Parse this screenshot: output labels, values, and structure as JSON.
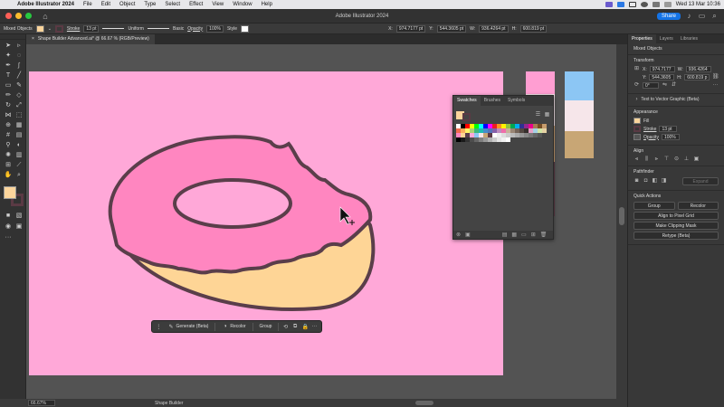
{
  "menubar": {
    "app": "Adobe Illustrator 2024",
    "items": [
      "File",
      "Edit",
      "Object",
      "Type",
      "Select",
      "Effect",
      "View",
      "Window",
      "Help"
    ],
    "datetime": "Wed 13 Mar  10:36"
  },
  "titlebar": {
    "title": "Adobe Illustrator 2024",
    "share": "Share"
  },
  "control": {
    "selection": "Mixed Objects",
    "stroke_label": "Stroke",
    "stroke_weight": "13 pt",
    "profile": "Uniform",
    "brush": "Basic",
    "opacity_label": "Opacity",
    "opacity": "100%",
    "style_label": "Style",
    "x": "974.7177 pt",
    "y": "544.3605 pt",
    "w": "936.4264 pt",
    "h": "600.819 pt",
    "fill_color": "#fcd59c",
    "stroke_color": "#5a3a44"
  },
  "doc": {
    "tab": "Shape Builder Advanced.ai* @ 66.67 % (RGB/Preview)",
    "close": "×"
  },
  "colors": {
    "artboard": "#ffa8d8",
    "frosting": "#ff86c0",
    "dough": "#fed596",
    "outline": "#5a3e4a"
  },
  "strips": [
    [
      "#ff9ed2",
      "#f6e6ea",
      "#c89d70",
      "#5c3a46"
    ],
    [
      "#8cc6f4",
      "#f6e6ea",
      "#c8a675"
    ]
  ],
  "swatches_panel": {
    "tabs": [
      "Swatches",
      "Brushes",
      "Symbols"
    ]
  },
  "taskbar": {
    "generate": "Generate (Beta)",
    "recolor": "Recolor",
    "group": "Group",
    "more": "···"
  },
  "status": {
    "zoom": "66.67%",
    "tool": "Shape Builder"
  },
  "properties": {
    "tabs": [
      "Properties",
      "Layers",
      "Libraries"
    ],
    "selection": "Mixed Objects",
    "transform_title": "Transform",
    "x": "974.7177",
    "y": "544.3605",
    "w": "936.4264",
    "h": "600.819 p",
    "angle": "0°",
    "text_to_vector": "Text to Vector Graphic (Beta)",
    "appearance_title": "Appearance",
    "fill_label": "Fill",
    "stroke_label": "Stroke",
    "stroke_weight": "13 pt",
    "opacity_label": "Opacity",
    "opacity": "100%",
    "align_title": "Align",
    "pathfinder_title": "Pathfinder",
    "expand": "Expand",
    "quick_actions_title": "Quick Actions",
    "group": "Group",
    "recolor": "Recolor",
    "align_pixel": "Align to Pixel Grid",
    "clipping_mask": "Make Clipping Mask",
    "retype": "Retype (Beta)"
  }
}
